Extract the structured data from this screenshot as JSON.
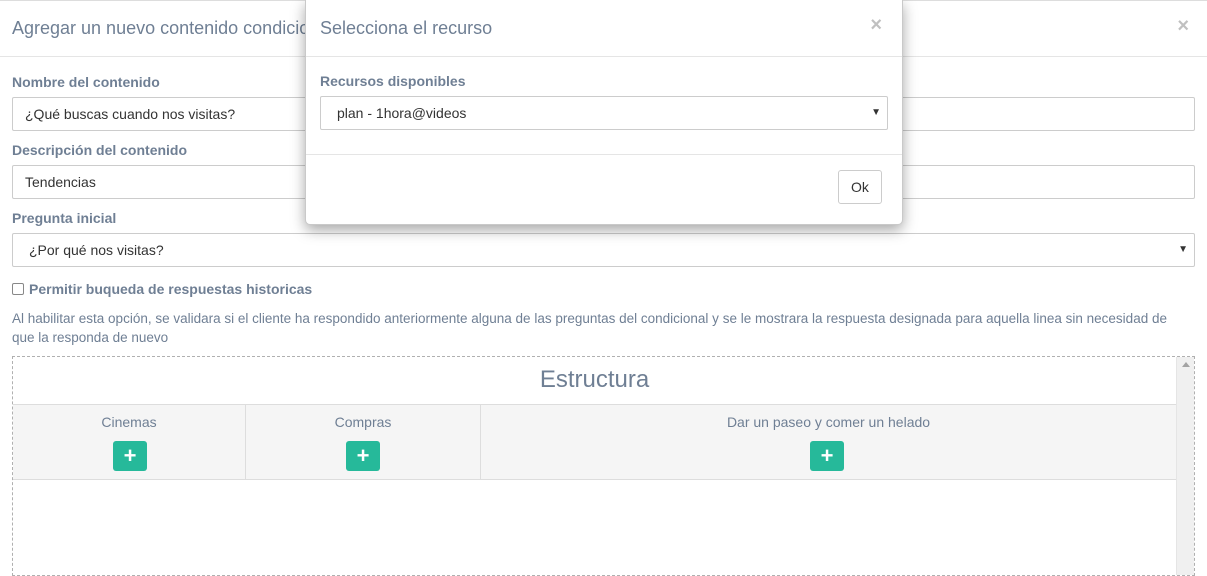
{
  "background_modal": {
    "title": "Agregar un nuevo contenido condicional",
    "close_symbol": "×",
    "fields": {
      "name_label": "Nombre del contenido",
      "name_value": "¿Qué buscas cuando nos visitas?",
      "description_label": "Descripción del contenido",
      "description_value": "Tendencias",
      "question_label": "Pregunta inicial",
      "question_value": "¿Por qué nos visitas?"
    },
    "checkbox": {
      "label": "Permitir buqueda de respuestas historicas",
      "checked": false
    },
    "help_text": "Al habilitar esta opción, se validara si el cliente ha respondido anteriormente alguna de las preguntas del condicional y se le mostrara la respuesta designada para aquella linea sin necesidad de que la responda de nuevo",
    "structure": {
      "title": "Estructura",
      "columns": [
        {
          "label": "Cinemas",
          "button": "+"
        },
        {
          "label": "Compras",
          "button": "+"
        },
        {
          "label": "Dar un paseo y comer un helado",
          "button": "+"
        }
      ]
    }
  },
  "resource_modal": {
    "title": "Selecciona el recurso",
    "close_symbol": "×",
    "label": "Recursos disponibles",
    "selected": "plan - 1hora@videos",
    "ok_label": "Ok"
  },
  "icons": {
    "caret": "caret-down-icon",
    "plus": "plus-icon",
    "close": "close-icon"
  },
  "colors": {
    "accent_green": "#26b99a",
    "label_text": "#6f7f94"
  }
}
